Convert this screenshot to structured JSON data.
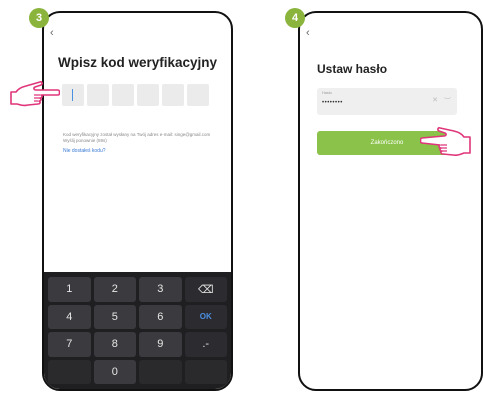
{
  "steps": {
    "left": "3",
    "right": "4"
  },
  "left_screen": {
    "back_icon": "chevron-left-icon",
    "title": "Wpisz kod weryfikacyjny",
    "code_boxes": 6,
    "info_text": "Kod weryfikacyjny został wysłany na Twój adres e-mail: singe@gmail.com Wyślij ponownie (59s)",
    "resend_link": "Nie dostałeś kodu?",
    "keyboard": {
      "keys": [
        "1",
        "2",
        "3",
        "⌫",
        "4",
        "5",
        "6",
        "OK",
        "7",
        "8",
        "9",
        ".-",
        "",
        "0",
        "",
        ""
      ]
    }
  },
  "right_screen": {
    "back_icon": "chevron-left-icon",
    "title": "Ustaw hasło",
    "password_label": "Hasło",
    "password_value": "••••••••",
    "finish_button": "Zakończono"
  },
  "colors": {
    "accent_green": "#8bc34a",
    "badge_green": "#8ab43c",
    "link_blue": "#3a7bd5",
    "hand_pink": "#e0357a"
  }
}
